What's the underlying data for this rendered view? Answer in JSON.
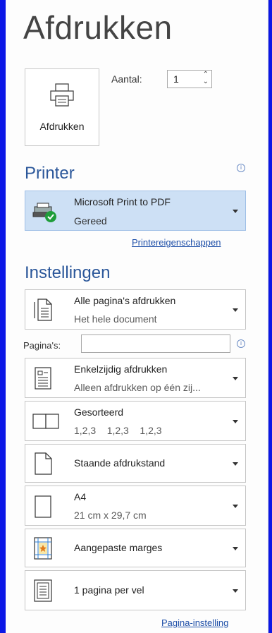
{
  "title": "Afdrukken",
  "print_button": {
    "label": "Afdrukken",
    "icon": "printer-icon"
  },
  "copies": {
    "label": "Aantal:",
    "value": "1"
  },
  "printer_section": {
    "heading": "Printer",
    "selected": {
      "name": "Microsoft Print to PDF",
      "status": "Gereed",
      "icon": "pdf-printer-ready-icon"
    },
    "properties_link": "Printereigenschappen"
  },
  "settings_section": {
    "heading": "Instellingen",
    "pages_label": "Pagina's:",
    "pages_value": "",
    "items": [
      {
        "line1": "Alle pagina's afdrukken",
        "line2": "Het hele document",
        "icon": "all-pages-icon"
      },
      {
        "line1": "Enkelzijdig afdrukken",
        "line2": "Alleen afdrukken op één zij...",
        "icon": "one-sided-icon"
      },
      {
        "line1": "Gesorteerd",
        "line2": "1,2,3    1,2,3    1,2,3",
        "icon": "collated-icon"
      },
      {
        "line1": "Staande afdrukstand",
        "line2": "",
        "icon": "portrait-icon"
      },
      {
        "line1": "A4",
        "line2": "21 cm x 29,7 cm",
        "icon": "paper-size-icon"
      },
      {
        "line1": "Aangepaste marges",
        "line2": "",
        "icon": "margins-icon"
      },
      {
        "line1": "1 pagina per vel",
        "line2": "",
        "icon": "pages-per-sheet-icon"
      }
    ],
    "page_setup_link": "Pagina-instelling"
  },
  "colors": {
    "accent": "#2b579a",
    "window_border": "#0b17e6",
    "selected_bg": "#cde0f5"
  }
}
